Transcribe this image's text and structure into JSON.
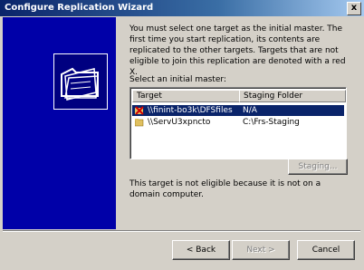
{
  "window": {
    "title": "Configure Replication Wizard",
    "close_glyph": "x"
  },
  "intro_text": "You must select one target as the initial master. The first time you start replication, its contents are replicated to the other targets. Targets that are not eligible to join this replication are denoted with a red X.",
  "select_label": "Select an initial master:",
  "columns": [
    "Target",
    "Staging Folder"
  ],
  "rows": [
    {
      "target": "\\\\finint-bo3k\\DFSfiles",
      "staging": "N/A",
      "icon": "ineligible-target-icon"
    },
    {
      "target": "\\\\ServU3xpncto",
      "staging": "C:\\Frs-Staging",
      "icon": "folder-share-icon"
    }
  ],
  "staging_button": "Staging...",
  "note_text": "This target is not eligible because it is not on a domain computer.",
  "buttons": {
    "back": "< Back",
    "next": "Next >",
    "cancel": "Cancel"
  },
  "colors": {
    "side_panel": "#0000a8",
    "selection": "#0a246a"
  }
}
